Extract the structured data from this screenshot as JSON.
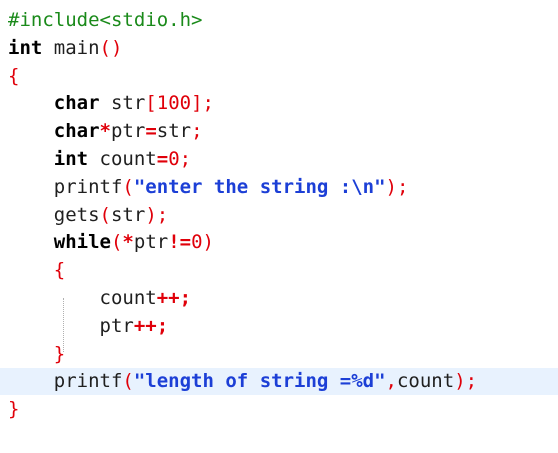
{
  "editor": {
    "lines": [
      {
        "tokens": [
          {
            "t": "#include<stdio.h>",
            "k": "preproc"
          }
        ]
      },
      {
        "tokens": [
          {
            "t": "int",
            "k": "keyword"
          },
          {
            "t": " main",
            "k": "plain"
          },
          {
            "t": "()",
            "k": "punct"
          }
        ]
      },
      {
        "tokens": [
          {
            "t": "{",
            "k": "punct"
          }
        ]
      },
      {
        "tokens": [
          {
            "t": "    ",
            "k": "plain"
          },
          {
            "t": "char",
            "k": "keyword"
          },
          {
            "t": " str",
            "k": "plain"
          },
          {
            "t": "[",
            "k": "punct"
          },
          {
            "t": "100",
            "k": "number"
          },
          {
            "t": "];",
            "k": "punct"
          }
        ]
      },
      {
        "tokens": [
          {
            "t": "    ",
            "k": "plain"
          },
          {
            "t": "char",
            "k": "keyword"
          },
          {
            "t": "*",
            "k": "op"
          },
          {
            "t": "ptr",
            "k": "plain"
          },
          {
            "t": "=",
            "k": "op"
          },
          {
            "t": "str",
            "k": "plain"
          },
          {
            "t": ";",
            "k": "punct"
          }
        ]
      },
      {
        "tokens": [
          {
            "t": "    ",
            "k": "plain"
          },
          {
            "t": "int",
            "k": "keyword"
          },
          {
            "t": " count",
            "k": "plain"
          },
          {
            "t": "=",
            "k": "op"
          },
          {
            "t": "0",
            "k": "number"
          },
          {
            "t": ";",
            "k": "punct"
          }
        ]
      },
      {
        "tokens": [
          {
            "t": "    ",
            "k": "plain"
          },
          {
            "t": "printf",
            "k": "plain"
          },
          {
            "t": "(",
            "k": "punct"
          },
          {
            "t": "\"enter the string :\\n\"",
            "k": "string"
          },
          {
            "t": ");",
            "k": "punct"
          }
        ]
      },
      {
        "tokens": [
          {
            "t": "    ",
            "k": "plain"
          },
          {
            "t": "gets",
            "k": "plain"
          },
          {
            "t": "(",
            "k": "punct"
          },
          {
            "t": "str",
            "k": "plain"
          },
          {
            "t": ");",
            "k": "punct"
          }
        ]
      },
      {
        "tokens": [
          {
            "t": "    ",
            "k": "plain"
          },
          {
            "t": "while",
            "k": "keyword"
          },
          {
            "t": "(",
            "k": "punct"
          },
          {
            "t": "*",
            "k": "op"
          },
          {
            "t": "ptr",
            "k": "plain"
          },
          {
            "t": "!=",
            "k": "op"
          },
          {
            "t": "0",
            "k": "number"
          },
          {
            "t": ")",
            "k": "punct"
          }
        ]
      },
      {
        "tokens": [
          {
            "t": "    ",
            "k": "plain"
          },
          {
            "t": "{",
            "k": "punct"
          }
        ]
      },
      {
        "tokens": [
          {
            "t": "        ",
            "k": "plain"
          },
          {
            "t": "count",
            "k": "plain"
          },
          {
            "t": "++;",
            "k": "op"
          }
        ]
      },
      {
        "tokens": [
          {
            "t": "        ",
            "k": "plain"
          },
          {
            "t": "ptr",
            "k": "plain"
          },
          {
            "t": "++;",
            "k": "op"
          }
        ]
      },
      {
        "tokens": [
          {
            "t": "    ",
            "k": "plain"
          },
          {
            "t": "}",
            "k": "punct"
          }
        ]
      },
      {
        "tokens": [
          {
            "t": "    ",
            "k": "plain"
          },
          {
            "t": "printf",
            "k": "plain"
          },
          {
            "t": "(",
            "k": "punct"
          },
          {
            "t": "\"length of string =%d\"",
            "k": "string"
          },
          {
            "t": ",",
            "k": "punct"
          },
          {
            "t": "count",
            "k": "plain"
          },
          {
            "t": ");",
            "k": "punct"
          }
        ]
      },
      {
        "tokens": [
          {
            "t": "}",
            "k": "punct"
          }
        ]
      }
    ],
    "current_line": 14,
    "colors": {
      "keyword": "#000000",
      "punct": "#e0000a",
      "string": "#1c3fd6",
      "preproc": "#1a8a1a",
      "current_line_bg": "#e8f2fe"
    }
  }
}
